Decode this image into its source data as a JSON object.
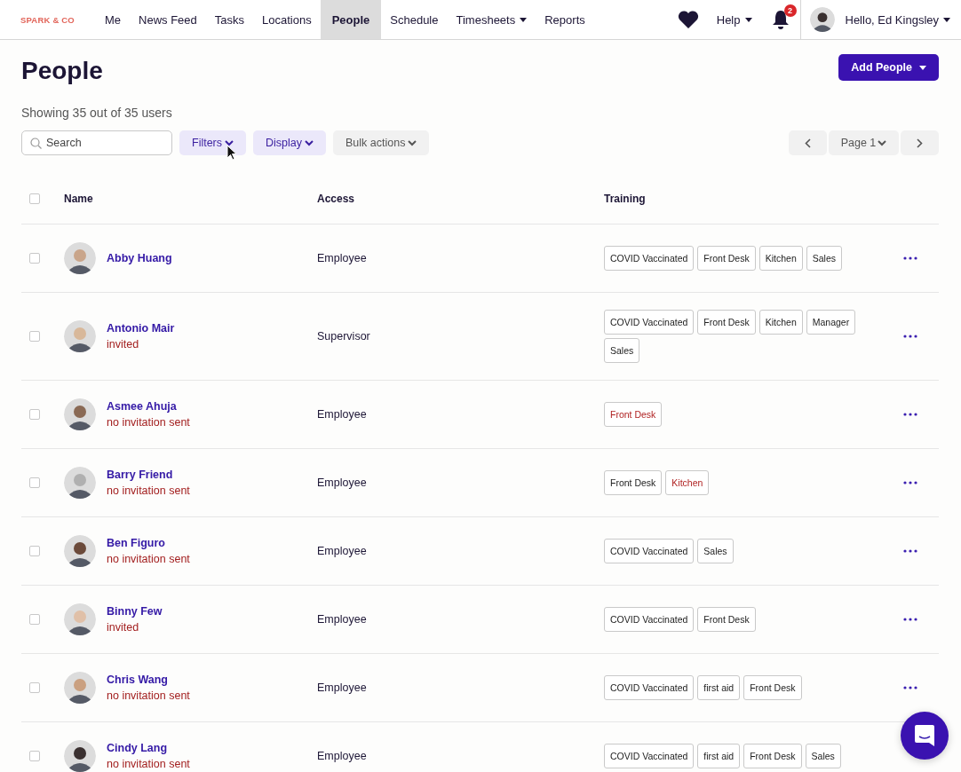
{
  "brand": "SPARK & CO",
  "nav": [
    {
      "label": "Me",
      "selected": false,
      "dropdown": false
    },
    {
      "label": "News Feed",
      "selected": false,
      "dropdown": false
    },
    {
      "label": "Tasks",
      "selected": false,
      "dropdown": false
    },
    {
      "label": "Locations",
      "selected": false,
      "dropdown": false
    },
    {
      "label": "People",
      "selected": true,
      "dropdown": false
    },
    {
      "label": "Schedule",
      "selected": false,
      "dropdown": false
    },
    {
      "label": "Timesheets",
      "selected": false,
      "dropdown": true
    },
    {
      "label": "Reports",
      "selected": false,
      "dropdown": false
    }
  ],
  "help": "Help",
  "notifications": "2",
  "greeting": "Hello, Ed Kingsley",
  "title": "People",
  "add_button": "Add People",
  "summary": "Showing 35 out of 35 users",
  "search": {
    "placeholder": "Search"
  },
  "toolbar": [
    {
      "label": "Filters",
      "kind": "accent"
    },
    {
      "label": "Display",
      "kind": "accent"
    },
    {
      "label": "Bulk actions",
      "kind": "plain"
    }
  ],
  "pager": {
    "page": "Page 1"
  },
  "table": {
    "columns": [
      "Name",
      "Access",
      "Training"
    ],
    "all_checked": false,
    "rows": [
      {
        "name": "Abby Huang",
        "actions": true,
        "access": "Employee",
        "checked": false,
        "training": [
          {
            "label": "COVID Vaccinated",
            "warning": false
          },
          {
            "label": "Front Desk",
            "warning": false
          },
          {
            "label": "Kitchen",
            "warning": false
          },
          {
            "label": "Sales",
            "warning": false
          }
        ]
      },
      {
        "name": "Antonio Mair",
        "status": "invited",
        "actions": true,
        "access": "Supervisor",
        "checked": false,
        "training": [
          {
            "label": "COVID Vaccinated",
            "warning": false
          },
          {
            "label": "Front Desk",
            "warning": false
          },
          {
            "label": "Kitchen",
            "warning": false
          },
          {
            "label": "Manager",
            "warning": false
          },
          {
            "label": "Sales",
            "warning": false
          }
        ]
      },
      {
        "name": "Asmee Ahuja",
        "status": "no invitation sent",
        "actions": true,
        "access": "Employee",
        "checked": false,
        "training": [
          {
            "label": "Front Desk",
            "warning": true
          }
        ]
      },
      {
        "name": "Barry Friend",
        "status": "no invitation sent",
        "actions": true,
        "access": "Employee",
        "checked": false,
        "training": [
          {
            "label": "Front Desk",
            "warning": false
          },
          {
            "label": "Kitchen",
            "warning": true
          }
        ]
      },
      {
        "name": "Ben Figuro",
        "status": "no invitation sent",
        "actions": true,
        "access": "Employee",
        "checked": false,
        "training": [
          {
            "label": "COVID Vaccinated",
            "warning": false
          },
          {
            "label": "Sales",
            "warning": false
          }
        ]
      },
      {
        "name": "Binny Few",
        "status": "invited",
        "actions": true,
        "access": "Employee",
        "checked": false,
        "training": [
          {
            "label": "COVID Vaccinated",
            "warning": false
          },
          {
            "label": "Front Desk",
            "warning": false
          }
        ]
      },
      {
        "name": "Chris Wang",
        "status": "no invitation sent",
        "actions": true,
        "access": "Employee",
        "checked": false,
        "training": [
          {
            "label": "COVID Vaccinated",
            "warning": false
          },
          {
            "label": "first aid",
            "warning": false
          },
          {
            "label": "Front Desk",
            "warning": false
          }
        ]
      },
      {
        "name": "Cindy Lang",
        "status": "no invitation sent",
        "actions": false,
        "access": "Employee",
        "checked": false,
        "training": [
          {
            "label": "COVID Vaccinated",
            "warning": false
          },
          {
            "label": "first aid",
            "warning": false
          },
          {
            "label": "Front Desk",
            "warning": false
          },
          {
            "label": "Sales",
            "warning": false
          }
        ]
      }
    ]
  }
}
